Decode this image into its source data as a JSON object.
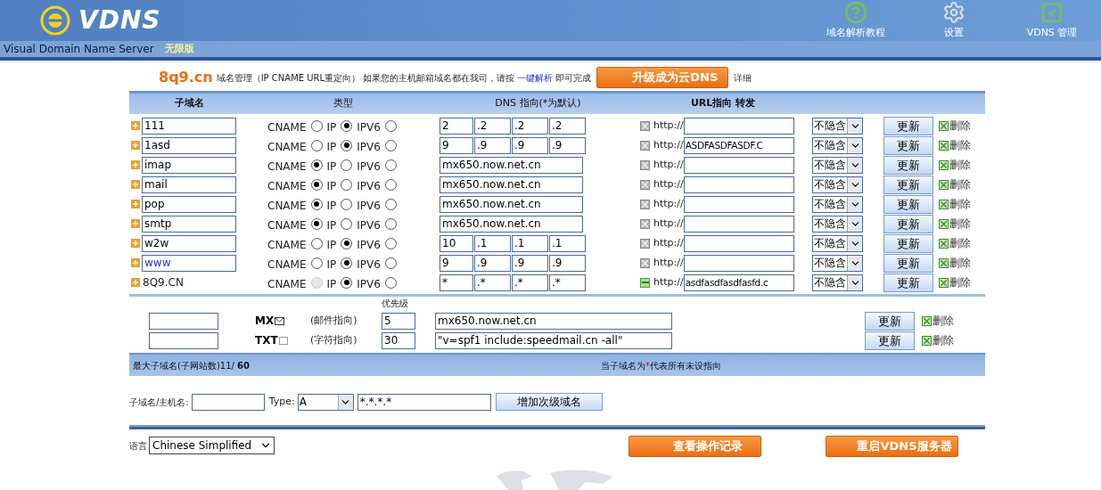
{
  "header": {
    "logo": "VDNS",
    "nav": [
      {
        "label": "域名解析教程",
        "kind": "help"
      },
      {
        "label": "设置",
        "kind": "settings"
      },
      {
        "label": "VDNS 管理",
        "kind": "manage"
      }
    ],
    "subtitle": "Visual Domain Name Server",
    "edition": "无限版"
  },
  "title": {
    "domain": "8q9.cn",
    "description": "域名管理（IP CNAME URL重定向） 如果您的主机邮箱域名都在我司，请按",
    "link": "一键解析",
    "suffix": "即可完成",
    "upgrade": "升级成为云DNS",
    "detail": "详细"
  },
  "table": {
    "columns": [
      "子域名",
      "类型",
      "DNS 指向(*为默认)",
      "URL指向 转发"
    ],
    "rows": [
      {
        "name": "111",
        "kind": "input",
        "linked": false,
        "types": [
          {
            "label": "CNAME",
            "selected": false,
            "disabled": false
          },
          {
            "label": "IP",
            "selected": true,
            "disabled": false
          },
          {
            "label": "IPV6",
            "selected": false,
            "disabled": false
          }
        ],
        "ip": [
          "2",
          ".2",
          ".2",
          ".2"
        ],
        "redirect": false,
        "url_prefix": "http://",
        "hide": "不隐含",
        "update": "更新",
        "delete": "删除"
      },
      {
        "name": "1asd",
        "kind": "input",
        "linked": false,
        "types": [
          {
            "label": "CNAME",
            "selected": false,
            "disabled": false
          },
          {
            "label": "IP",
            "selected": true,
            "disabled": false
          },
          {
            "label": "IPV6",
            "selected": false,
            "disabled": false
          }
        ],
        "ip": [
          "9",
          ".9",
          ".9",
          ".9"
        ],
        "redirect": false,
        "url_prefix": "http://",
        "url": "ASDFASDFASDF.C",
        "hide": "不隐含",
        "update": "更新",
        "delete": "删除"
      },
      {
        "name": "imap",
        "kind": "input",
        "linked": false,
        "types": [
          {
            "label": "CNAME",
            "selected": true,
            "disabled": false
          },
          {
            "label": "IP",
            "selected": false,
            "disabled": false
          },
          {
            "label": "IPV6",
            "selected": false,
            "disabled": false
          }
        ],
        "host": "mx650.now.net.cn",
        "redirect": false,
        "url_prefix": "http://",
        "hide": "不隐含",
        "update": "更新",
        "delete": "删除"
      },
      {
        "name": "mail",
        "kind": "input",
        "linked": false,
        "types": [
          {
            "label": "CNAME",
            "selected": true,
            "disabled": false
          },
          {
            "label": "IP",
            "selected": false,
            "disabled": false
          },
          {
            "label": "IPV6",
            "selected": false,
            "disabled": false
          }
        ],
        "host": "mx650.now.net.cn",
        "redirect": false,
        "url_prefix": "http://",
        "hide": "不隐含",
        "update": "更新",
        "delete": "删除"
      },
      {
        "name": "pop",
        "kind": "input",
        "linked": false,
        "types": [
          {
            "label": "CNAME",
            "selected": true,
            "disabled": false
          },
          {
            "label": "IP",
            "selected": false,
            "disabled": false
          },
          {
            "label": "IPV6",
            "selected": false,
            "disabled": false
          }
        ],
        "host": "mx650.now.net.cn",
        "redirect": false,
        "url_prefix": "http://",
        "hide": "不隐含",
        "update": "更新",
        "delete": "删除"
      },
      {
        "name": "smtp",
        "kind": "input",
        "linked": false,
        "types": [
          {
            "label": "CNAME",
            "selected": true,
            "disabled": false
          },
          {
            "label": "IP",
            "selected": false,
            "disabled": false
          },
          {
            "label": "IPV6",
            "selected": false,
            "disabled": false
          }
        ],
        "host": "mx650.now.net.cn",
        "redirect": false,
        "url_prefix": "http://",
        "hide": "不隐含",
        "update": "更新",
        "delete": "删除"
      },
      {
        "name": "w2w",
        "kind": "input",
        "linked": false,
        "types": [
          {
            "label": "CNAME",
            "selected": false,
            "disabled": false
          },
          {
            "label": "IP",
            "selected": true,
            "disabled": false
          },
          {
            "label": "IPV6",
            "selected": false,
            "disabled": false
          }
        ],
        "ip": [
          "10",
          ".1",
          ".1",
          ".1"
        ],
        "redirect": false,
        "url_prefix": "http://",
        "hide": "不隐含",
        "update": "更新",
        "delete": "删除"
      },
      {
        "name": "www",
        "kind": "input",
        "linked": true,
        "types": [
          {
            "label": "CNAME",
            "selected": false,
            "disabled": false
          },
          {
            "label": "IP",
            "selected": true,
            "disabled": false
          },
          {
            "label": "IPV6",
            "selected": false,
            "disabled": false
          }
        ],
        "ip": [
          "9",
          ".9",
          ".9",
          ".9"
        ],
        "redirect": false,
        "url_prefix": "http://",
        "hide": "不隐含",
        "update": "更新",
        "delete": "删除"
      },
      {
        "name": "8Q9.CN",
        "kind": "text",
        "linked": false,
        "types": [
          {
            "label": "CNAME",
            "selected": false,
            "disabled": true
          },
          {
            "label": "IP",
            "selected": true,
            "disabled": false
          },
          {
            "label": "IPV6",
            "selected": false,
            "disabled": false
          }
        ],
        "ip": [
          "*",
          ".*",
          ".*",
          ".*"
        ],
        "redirect": true,
        "url_prefix": "http://",
        "url": "asdfasdfasdfasfd.c",
        "hide": "不隐含",
        "update": "更新",
        "delete": "删除"
      }
    ]
  },
  "priority_label": "优先级",
  "records": [
    {
      "type": "MX",
      "kind": "mail",
      "note": "(邮件指向)",
      "priority": "5",
      "value": "mx650.now.net.cn",
      "update": "更新",
      "delete": "删除"
    },
    {
      "type": "TXT",
      "kind": "text",
      "note": "(字符指向)",
      "priority": "30",
      "value": "\"v=spf1 include:speedmail.cn -all\"",
      "update": "更新",
      "delete": "删除"
    }
  ],
  "status": {
    "count": "最大子域名(子网站数)11/ **60**",
    "hint_prefix": "当子域名为",
    "hint_star": "*",
    "hint_suffix": "代表所有未设指向"
  },
  "add_form": {
    "name_label": "子域名/主机名:",
    "type_label": "Type:",
    "type": "A",
    "value": "*.*.*.*",
    "button": "增加次级域名"
  },
  "footer": {
    "language_label": "语言",
    "language": "Chinese Simplified",
    "log_button": "查看操作记录",
    "restart_button": "重启VDNS服务器"
  }
}
